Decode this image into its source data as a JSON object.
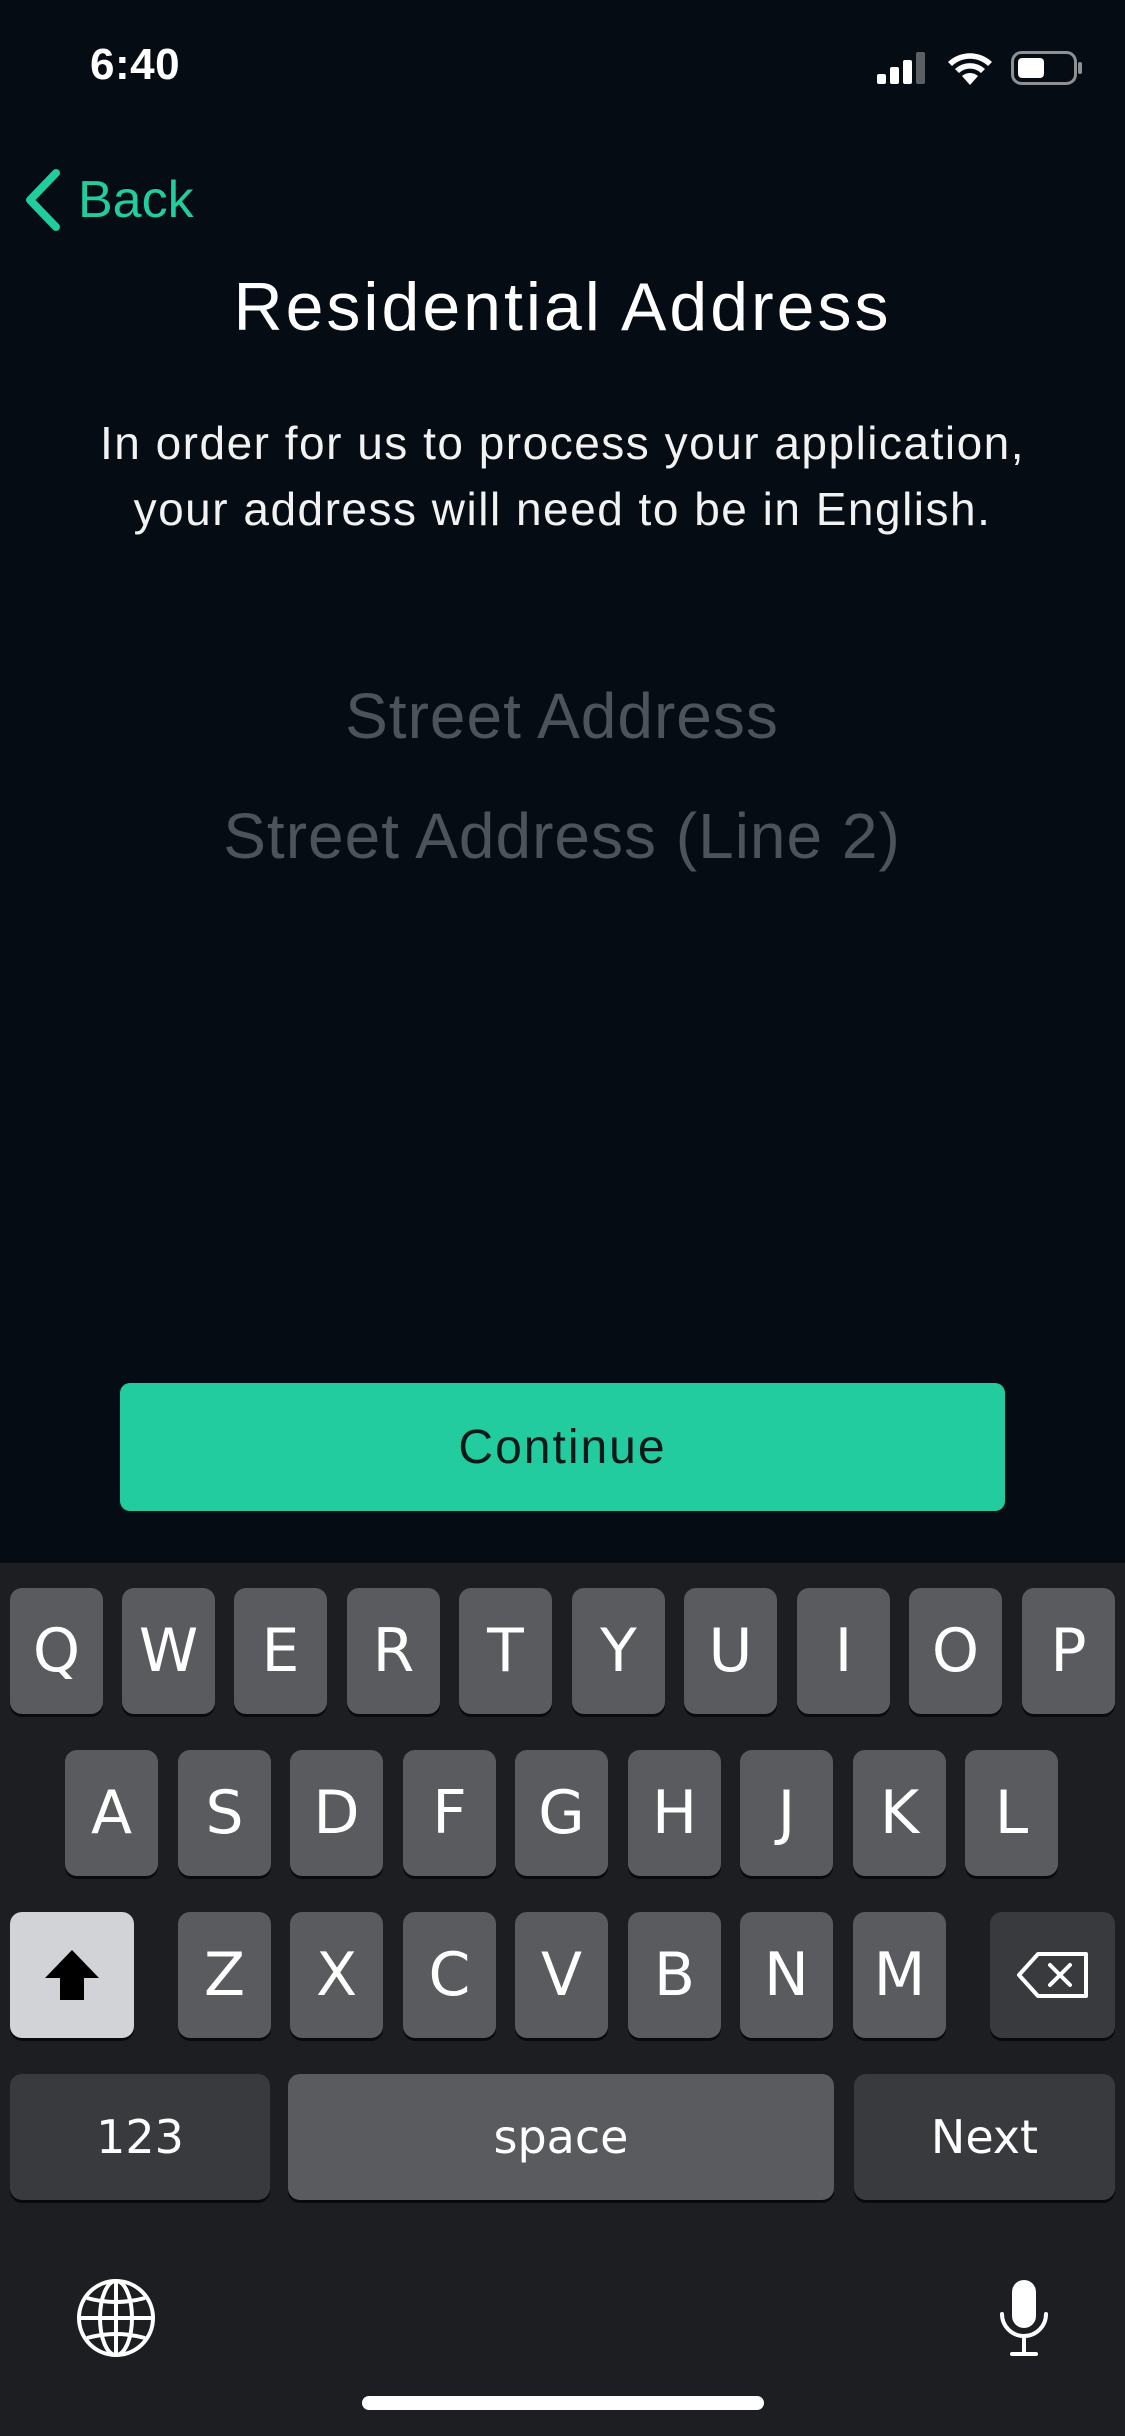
{
  "status_bar": {
    "time": "6:40",
    "icons": [
      "cellular-signal-icon",
      "wifi-icon",
      "battery-icon"
    ]
  },
  "nav": {
    "back_label": "Back"
  },
  "header": {
    "title": "Residential Address",
    "subtitle": "In order for us to process your application, your address will need to be in English."
  },
  "form": {
    "street_address": {
      "value": "",
      "placeholder": "Street Address"
    },
    "street_address_line2": {
      "value": "",
      "placeholder": "Street Address (Line 2)"
    }
  },
  "actions": {
    "continue_label": "Continue"
  },
  "keyboard": {
    "row1": [
      "Q",
      "W",
      "E",
      "R",
      "T",
      "Y",
      "U",
      "I",
      "O",
      "P"
    ],
    "row2": [
      "A",
      "S",
      "D",
      "F",
      "G",
      "H",
      "J",
      "K",
      "L"
    ],
    "row3": [
      "Z",
      "X",
      "C",
      "V",
      "B",
      "N",
      "M"
    ],
    "numbers_label": "123",
    "space_label": "space",
    "return_label": "Next"
  },
  "colors": {
    "background": "#060c14",
    "accent": "#22cc9e",
    "placeholder": "#4c535b",
    "keyboard_bg": "#1c1e22",
    "key": "#5a5b5e",
    "key_dark": "#393a3d"
  }
}
